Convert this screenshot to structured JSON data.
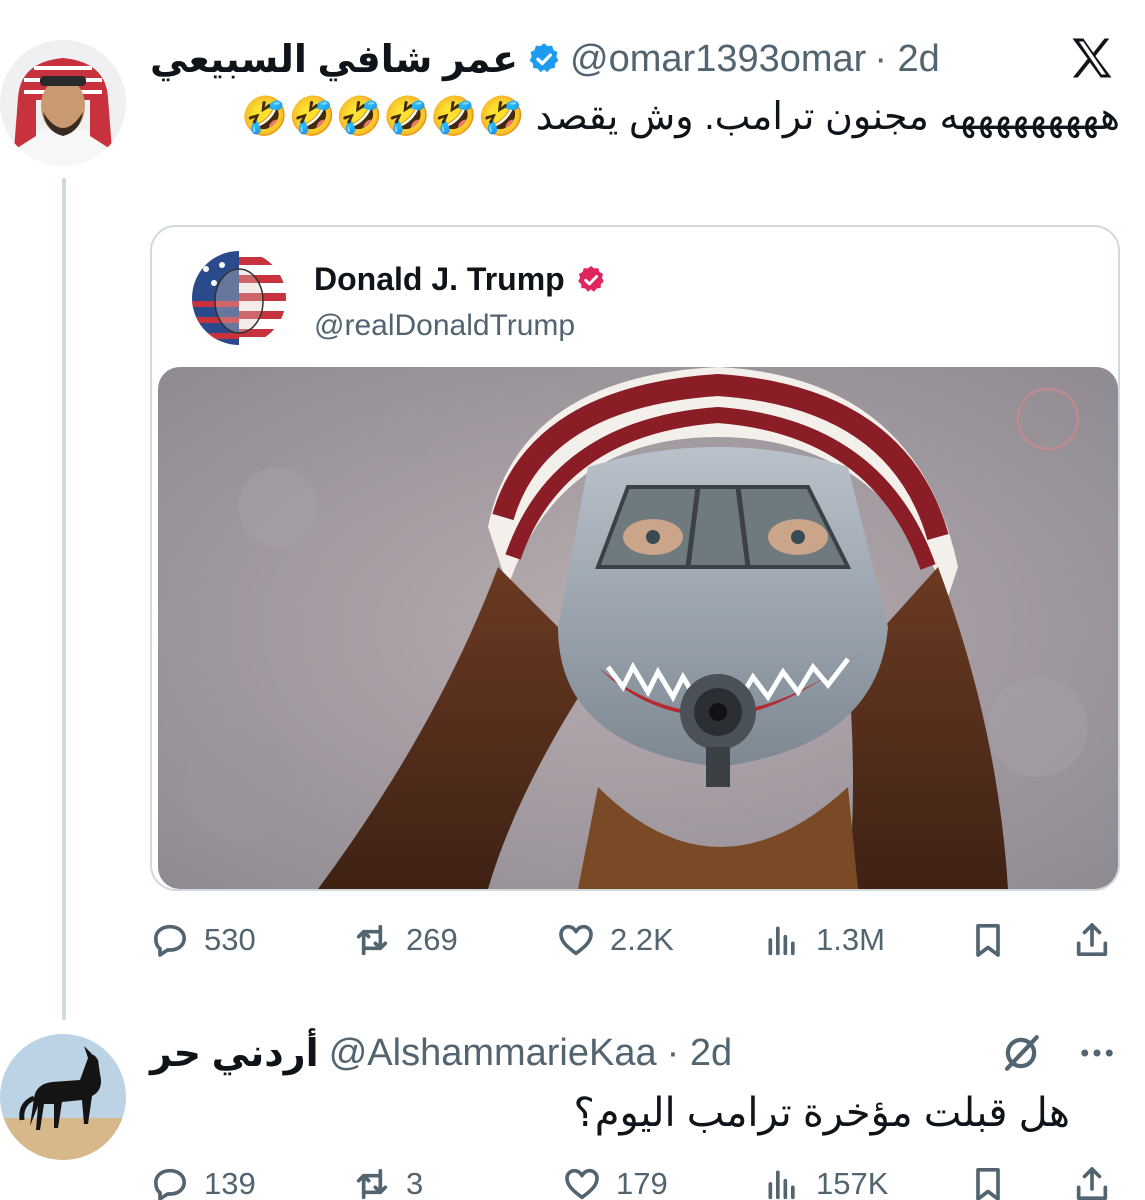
{
  "tweet": {
    "author_name": "عمر شافي السبيعي",
    "handle": "@omar1393omar",
    "time": "· 2d",
    "text": "هههههههههه مجنون ترامب. وش يقصد 🤣🤣🤣🤣🤣🤣",
    "quoted": {
      "author_name": "Donald J. Trump",
      "handle": "@realDonaldTrump",
      "image_icon": "meme-image"
    },
    "stats": {
      "replies": "530",
      "reposts": "269",
      "likes": "2.2K",
      "views": "1.3M"
    }
  },
  "reply": {
    "author_name": "أردني حر",
    "handle": "@AlshammarieKaa",
    "time": "· 2d",
    "text": "هل قبلت مؤخرة ترامب اليوم؟",
    "stats": {
      "replies": "139",
      "reposts": "3",
      "likes": "179",
      "views": "157K"
    }
  },
  "colors": {
    "verified_blue": "#1d9bf0",
    "verified_gold": "#e0245e",
    "muted": "#536471",
    "line": "#cfd9de"
  },
  "icons": [
    "x-logo-icon",
    "verified-badge-icon",
    "reply-icon",
    "repost-icon",
    "like-icon",
    "views-icon",
    "bookmark-icon",
    "share-icon",
    "grok-icon",
    "more-icon"
  ]
}
